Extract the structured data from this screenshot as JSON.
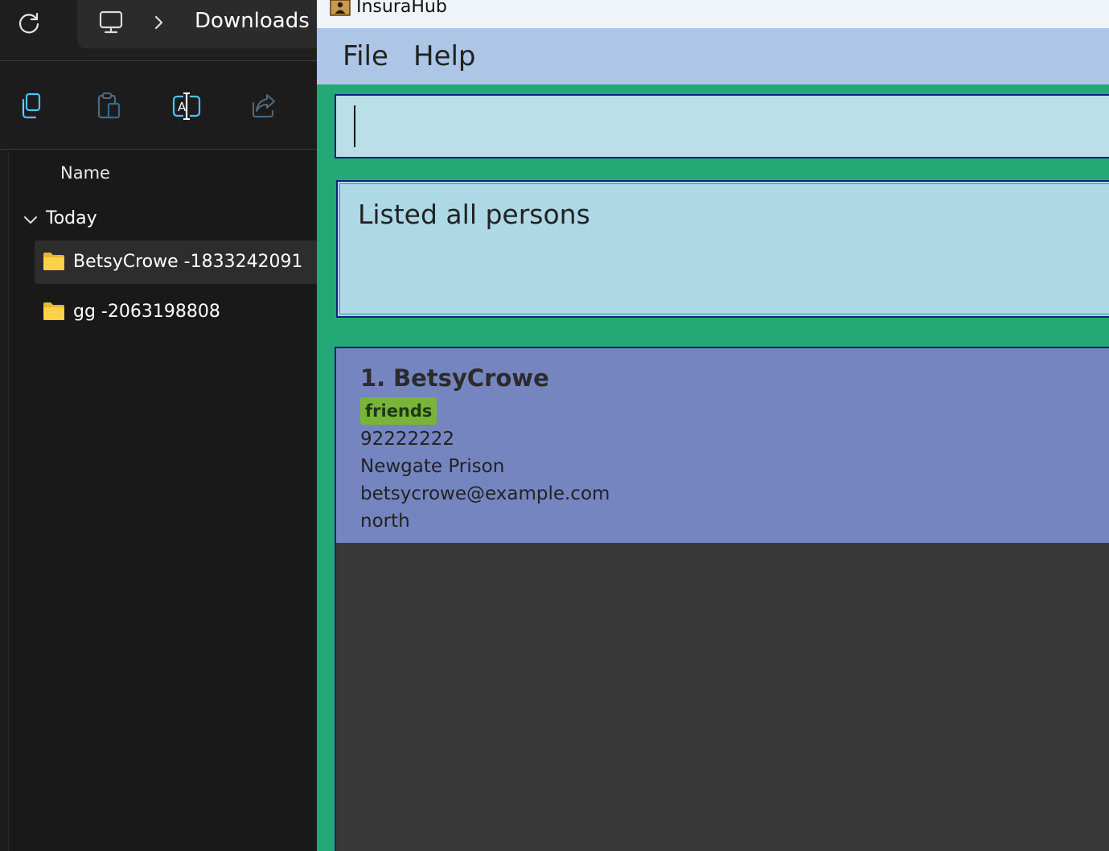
{
  "explorer": {
    "address_bar": {
      "location": "Downloads"
    },
    "column_header": "Name",
    "group": "Today",
    "items": [
      {
        "name": "BetsyCrowe -1833242091",
        "selected": true
      },
      {
        "name": "gg -2063198808",
        "selected": false
      }
    ],
    "command_icons": [
      "copy-icon",
      "paste-icon",
      "rename-icon",
      "share-icon"
    ],
    "colors": {
      "accent": "#4cc2ff",
      "folder": "#ffd04a"
    }
  },
  "app": {
    "title": "InsuraHub",
    "menu": {
      "file": "File",
      "help": "Help"
    },
    "command_box": {
      "value": ""
    },
    "result_display": "Listed all persons",
    "persons": [
      {
        "index": "1.",
        "name": "BetsyCrowe",
        "tags": [
          "friends"
        ],
        "phone": "92222222",
        "address": "Newgate Prison",
        "email": "betsycrowe@example.com",
        "region": "north"
      }
    ],
    "colors": {
      "background": "#24a875",
      "menu": "#adc6e6",
      "command_box": "#badfe9",
      "result_box": "#add8e6",
      "card": "#7585c0",
      "tag": "#7ab33a",
      "list_background": "#383838"
    }
  }
}
